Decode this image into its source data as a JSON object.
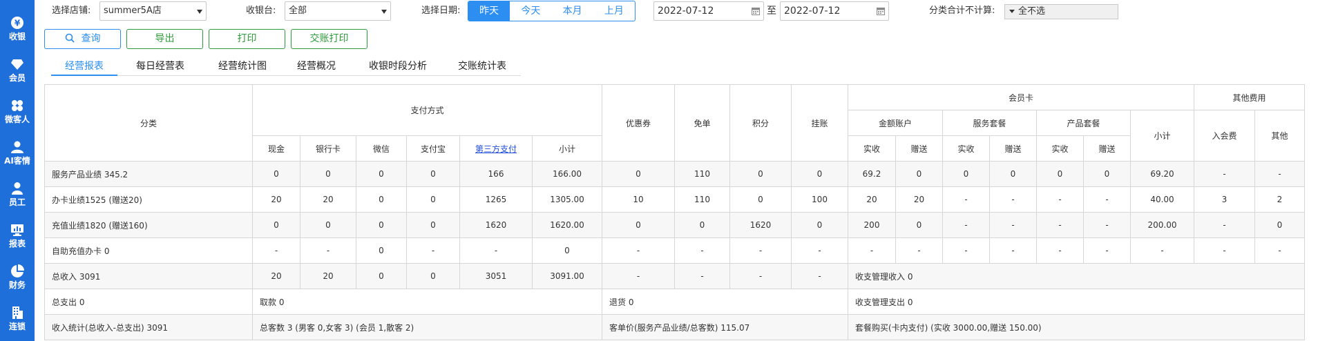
{
  "sidebar": [
    {
      "label": "收银",
      "icon": "cashier-icon"
    },
    {
      "label": "会员",
      "icon": "member-icon"
    },
    {
      "label": "微客人",
      "icon": "micro-guest-icon"
    },
    {
      "label": "AI客情",
      "icon": "ai-customer-icon"
    },
    {
      "label": "员工",
      "icon": "staff-icon"
    },
    {
      "label": "报表",
      "icon": "report-icon"
    },
    {
      "label": "财务",
      "icon": "finance-icon"
    },
    {
      "label": "连锁",
      "icon": "chain-icon"
    }
  ],
  "filters": {
    "store_label": "选择店铺:",
    "store_value": "summer5A店",
    "cashier_label": "收银台:",
    "cashier_value": "全部",
    "date_label": "选择日期:",
    "quick_dates": [
      "昨天",
      "今天",
      "本月",
      "上月"
    ],
    "date_from": "2022-07-12",
    "date_to_sep": "至",
    "date_to": "2022-07-12",
    "exclude_label": "分类合计不计算:",
    "exclude_value": "全不选"
  },
  "buttons": {
    "query": "查询",
    "export": "导出",
    "print": "打印",
    "shift_print": "交账打印"
  },
  "tabs": [
    "经营报表",
    "每日经营表",
    "经营统计图",
    "经营概况",
    "收银时段分析",
    "交账统计表"
  ],
  "table": {
    "h_category": "分类",
    "h_payment": "支付方式",
    "h_pay_cols": [
      "现金",
      "银行卡",
      "微信",
      "支付宝",
      "第三方支付",
      "小计"
    ],
    "h_coupon": "优惠券",
    "h_free": "免单",
    "h_points": "积分",
    "h_credit": "挂账",
    "h_member_card": "会员卡",
    "h_member_groups": [
      "金额账户",
      "服务套餐",
      "产品套餐"
    ],
    "h_member_subtotal": "小计",
    "h_received": "实收",
    "h_gift": "赠送",
    "h_other_fees": "其他费用",
    "h_other_cols": [
      "入会费",
      "其他"
    ],
    "rows": [
      {
        "label": "服务产品业绩 345.2",
        "cells": [
          "0",
          "0",
          "0",
          "0",
          "166",
          "166.00",
          "0",
          "110",
          "0",
          "0",
          "69.2",
          "0",
          "0",
          "0",
          "0",
          "0",
          "69.20",
          "-",
          "-"
        ]
      },
      {
        "label": "办卡业绩1525 (赠送20)",
        "cells": [
          "20",
          "20",
          "0",
          "0",
          "1265",
          "1305.00",
          "10",
          "110",
          "0",
          "100",
          "20",
          "20",
          "-",
          "-",
          "-",
          "-",
          "40.00",
          "3",
          "2"
        ]
      },
      {
        "label": "充值业绩1820 (赠送160)",
        "cells": [
          "0",
          "0",
          "0",
          "0",
          "1620",
          "1620.00",
          "0",
          "0",
          "1620",
          "0",
          "200",
          "0",
          "-",
          "-",
          "-",
          "-",
          "200.00",
          "-",
          "0"
        ]
      },
      {
        "label": "自助充值办卡 0",
        "cells": [
          "-",
          "-",
          "0",
          "-",
          "-",
          "0",
          "-",
          "-",
          "-",
          "-",
          "-",
          "-",
          "-",
          "-",
          "-",
          "-",
          "-",
          "-",
          "-"
        ]
      }
    ],
    "total_row": {
      "label": "总收入 3091",
      "cells": [
        "20",
        "20",
        "0",
        "0",
        "3051",
        "3091.00",
        "-",
        "-",
        "-",
        "-"
      ],
      "mgmt_income": "收支管理收入 0"
    },
    "expense_row": {
      "label": "总支出 0",
      "withdraw": "取款 0",
      "refund": "退货 0",
      "mgmt_expense": "收支管理支出 0"
    },
    "stats_row": {
      "label": "收入统计(总收入-总支出) 3091",
      "guests": "总客数 3 (男客 0,女客 3) (会员 1,散客 2)",
      "unit_price": "客单价(服务产品业绩/总客数) 115.07",
      "package": "套餐购买(卡内支付) (实收 3000.00,赠送 150.00)"
    }
  }
}
